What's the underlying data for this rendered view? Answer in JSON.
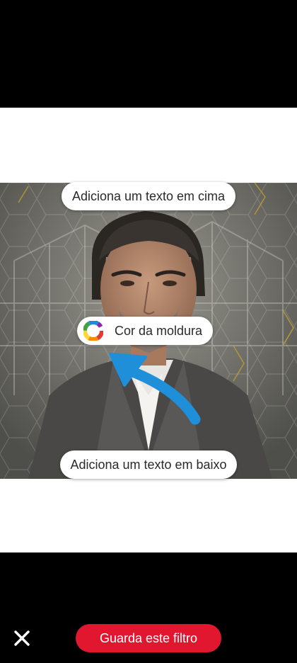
{
  "frame_editor": {
    "top_text_placeholder": "Adiciona um texto em cima",
    "frame_color_label": "Cor da moldura",
    "bottom_text_placeholder": "Adiciona um texto em baixo"
  },
  "bottom_bar": {
    "close_icon": "close-icon",
    "save_label": "Guarda este filtro"
  },
  "colors": {
    "background": "#000000",
    "frame": "#ffffff",
    "accent_red": "#e0172f",
    "hint_arrow": "#1e8fd8",
    "hex_gold": "#c9a227"
  }
}
